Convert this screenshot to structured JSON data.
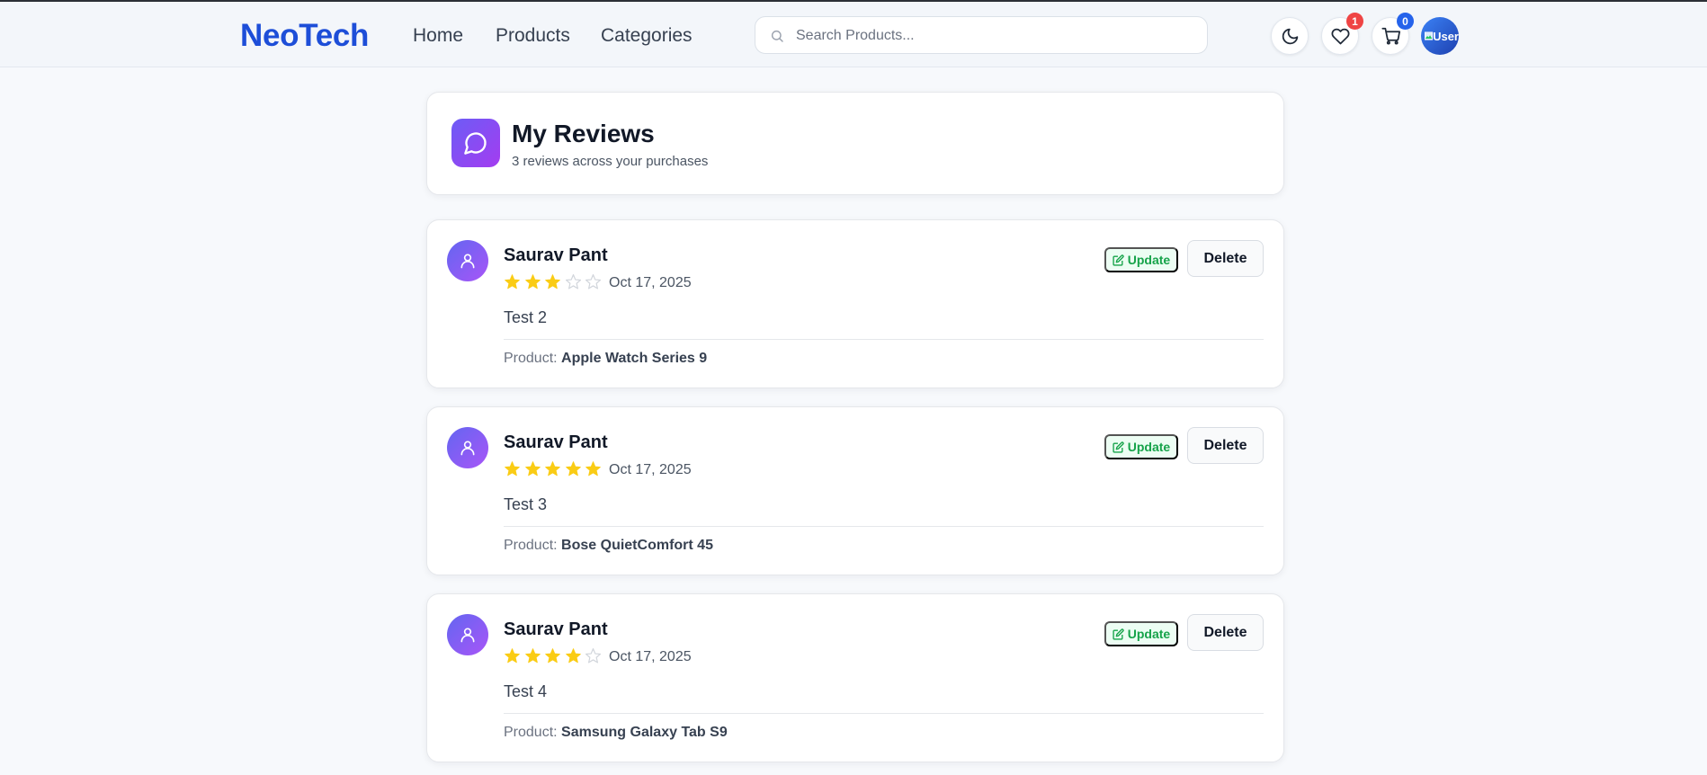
{
  "navbar": {
    "logo": "NeoTech",
    "links": [
      "Home",
      "Products",
      "Categories"
    ],
    "search_placeholder": "Search Products...",
    "theme_icon": "moon-icon",
    "wishlist": {
      "icon": "heart-icon",
      "count": "1",
      "badge_color": "#ef4444"
    },
    "cart": {
      "icon": "cart-icon",
      "count": "0",
      "badge_color": "#2563eb"
    },
    "avatar_alt": "User"
  },
  "header": {
    "title": "My Reviews",
    "subtitle": "3 reviews across your purchases",
    "icon": "message-circle-icon"
  },
  "reviews": [
    {
      "user": "Saurav Pant",
      "rating": 3,
      "max_rating": 5,
      "date": "Oct 17, 2025",
      "text": "Test 2",
      "product_label": "Product:",
      "product": "Apple Watch Series 9",
      "update_label": "Update",
      "delete_label": "Delete"
    },
    {
      "user": "Saurav Pant",
      "rating": 5,
      "max_rating": 5,
      "date": "Oct 17, 2025",
      "text": "Test 3",
      "product_label": "Product:",
      "product": "Bose QuietComfort 45",
      "update_label": "Update",
      "delete_label": "Delete"
    },
    {
      "user": "Saurav Pant",
      "rating": 4,
      "max_rating": 5,
      "date": "Oct 17, 2025",
      "text": "Test 4",
      "product_label": "Product:",
      "product": "Samsung Galaxy Tab S9",
      "update_label": "Update",
      "delete_label": "Delete"
    }
  ],
  "colors": {
    "brand": "#1d4ed8",
    "star_filled": "#facc15",
    "star_empty": "#d1d5db",
    "update": "#16a34a"
  }
}
